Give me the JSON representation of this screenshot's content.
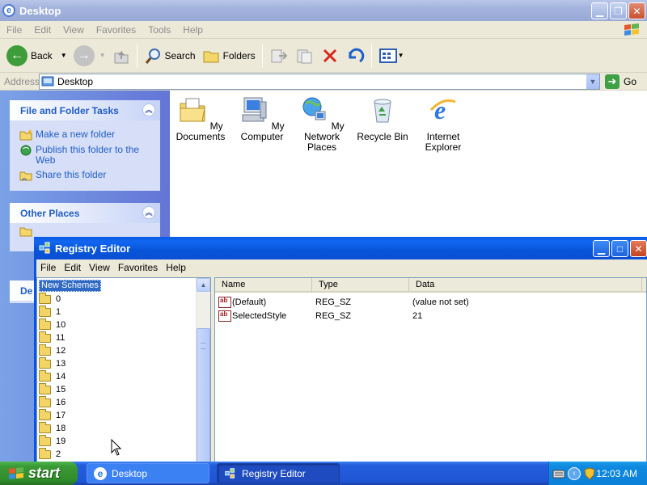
{
  "explorer": {
    "title": "Desktop",
    "menu": [
      "File",
      "Edit",
      "View",
      "Favorites",
      "Tools",
      "Help"
    ],
    "toolbar": {
      "back_label": "Back",
      "search_label": "Search",
      "folders_label": "Folders"
    },
    "address": {
      "label": "Address",
      "value": "Desktop",
      "go_label": "Go"
    },
    "tasks": {
      "file_folder_title": "File and Folder Tasks",
      "file_folder_items": [
        "Make a new folder",
        "Publish this folder to the Web",
        "Share this folder"
      ],
      "other_places_title": "Other Places",
      "details_title_partial": "De"
    },
    "desktop_icons": [
      {
        "label": "My Documents",
        "icon": "my-documents-icon"
      },
      {
        "label": "My Computer",
        "icon": "my-computer-icon"
      },
      {
        "label": "My Network Places",
        "icon": "network-places-icon"
      },
      {
        "label": "Recycle Bin",
        "icon": "recycle-bin-icon"
      },
      {
        "label": "Internet Explorer",
        "icon": "internet-explorer-icon"
      }
    ]
  },
  "registry": {
    "title": "Registry Editor",
    "menu": [
      "File",
      "Edit",
      "View",
      "Favorites",
      "Help"
    ],
    "tree": {
      "root": "New Schemes",
      "items": [
        "0",
        "1",
        "10",
        "11",
        "12",
        "13",
        "14",
        "15",
        "16",
        "17",
        "18",
        "19",
        "2"
      ]
    },
    "list": {
      "columns": [
        "Name",
        "Type",
        "Data"
      ],
      "rows": [
        {
          "name": "(Default)",
          "type": "REG_SZ",
          "data": "(value not set)"
        },
        {
          "name": "SelectedStyle",
          "type": "REG_SZ",
          "data": "21"
        }
      ]
    }
  },
  "taskbar": {
    "start_label": "start",
    "tasks": [
      "Desktop",
      "Registry Editor"
    ],
    "clock": "12:03 AM"
  },
  "colors": {
    "xp_blue": "#0a54e4",
    "taskbar_green": "#3a9a36",
    "link_blue": "#215dc6"
  }
}
